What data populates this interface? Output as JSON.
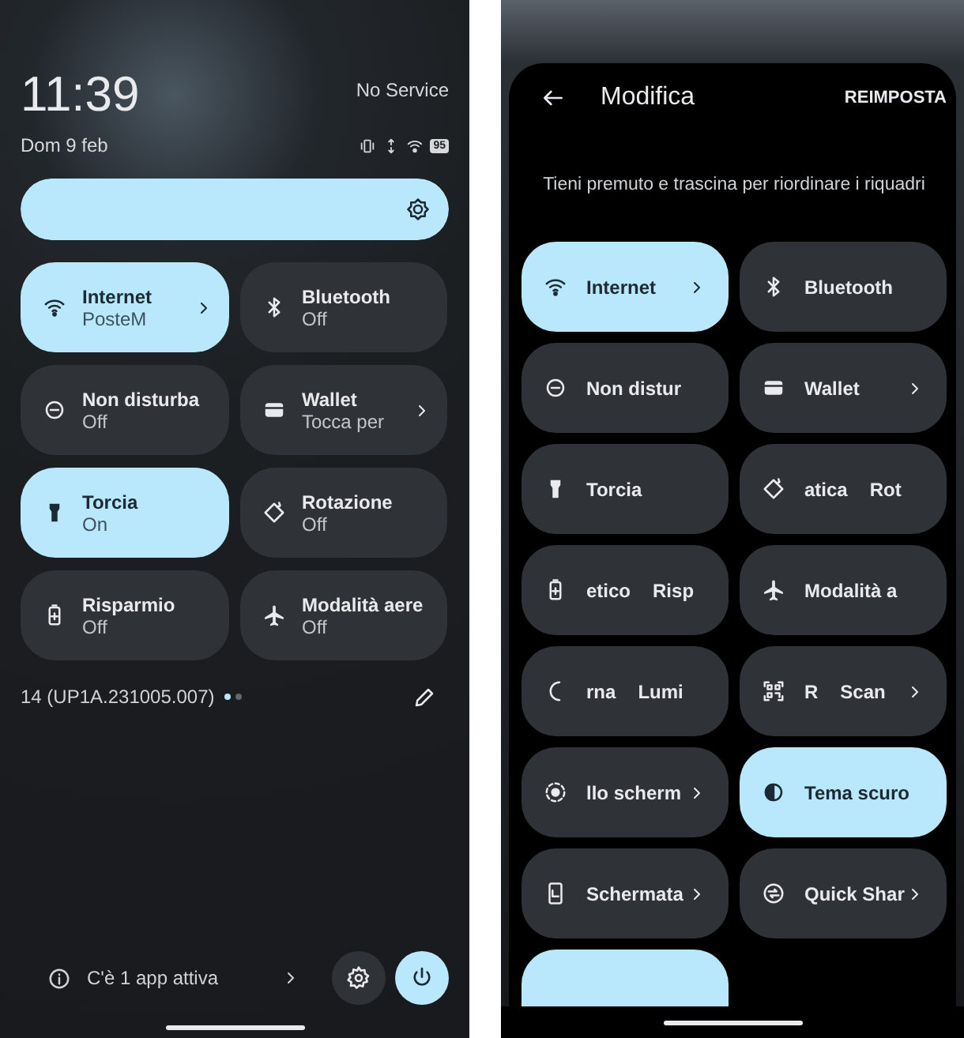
{
  "left": {
    "time": "11:39",
    "carrier": "No Service",
    "date": "Dom 9 feb",
    "battery": "95",
    "brightness": {
      "level": 1.0
    },
    "tiles": [
      {
        "title": "Internet",
        "subtitle": "PosteM",
        "on": true,
        "chevron": true
      },
      {
        "title": "Bluetooth",
        "subtitle": "Off",
        "on": false,
        "chevron": false
      },
      {
        "title": "Non disturba",
        "subtitle": "Off",
        "on": false,
        "chevron": false
      },
      {
        "title": "Wallet",
        "subtitle": "Tocca per",
        "on": false,
        "chevron": true
      },
      {
        "title": "Torcia",
        "subtitle": "On",
        "on": true,
        "chevron": false
      },
      {
        "title": "Rotazione",
        "subtitle": "Off",
        "on": false,
        "chevron": false
      },
      {
        "title": "Risparmio",
        "subtitle": "Off",
        "on": false,
        "chevron": false
      },
      {
        "title": "Modalità aere",
        "subtitle": "Off",
        "on": false,
        "chevron": false
      }
    ],
    "build": "14 (UP1A.231005.007)",
    "pages": [
      {
        "selected": true
      },
      {
        "selected": false
      }
    ],
    "active_apps": "C'è 1 app attiva"
  },
  "right": {
    "title": "Modifica",
    "reset": "REIMPOSTA",
    "hint": "Tieni premuto e trascina per riordinare i riquadri",
    "tiles": [
      {
        "labels": [
          "Internet"
        ],
        "on": true,
        "chevron": true
      },
      {
        "labels": [
          "Bluetooth"
        ],
        "on": false,
        "chevron": false
      },
      {
        "labels": [
          "Non distur"
        ],
        "on": false,
        "chevron": false
      },
      {
        "labels": [
          "Wallet"
        ],
        "on": false,
        "chevron": true
      },
      {
        "labels": [
          "Torcia"
        ],
        "on": false,
        "chevron": false
      },
      {
        "labels": [
          "atica",
          "Rot"
        ],
        "on": false,
        "chevron": false
      },
      {
        "labels": [
          "etico",
          "Risp"
        ],
        "on": false,
        "chevron": false
      },
      {
        "labels": [
          "Modalità a"
        ],
        "on": false,
        "chevron": false
      },
      {
        "labels": [
          "rna",
          "Lumi"
        ],
        "on": false,
        "chevron": false
      },
      {
        "labels": [
          "R",
          "Scan"
        ],
        "on": false,
        "chevron": true
      },
      {
        "labels": [
          "llo scherm"
        ],
        "on": false,
        "chevron": true
      },
      {
        "labels": [
          "Tema scuro"
        ],
        "on": true,
        "chevron": false
      },
      {
        "labels": [
          "Schermata"
        ],
        "on": false,
        "chevron": true
      },
      {
        "labels": [
          "Quick Shar"
        ],
        "on": false,
        "chevron": true
      },
      {
        "on": true,
        "chevron": false
      }
    ]
  }
}
